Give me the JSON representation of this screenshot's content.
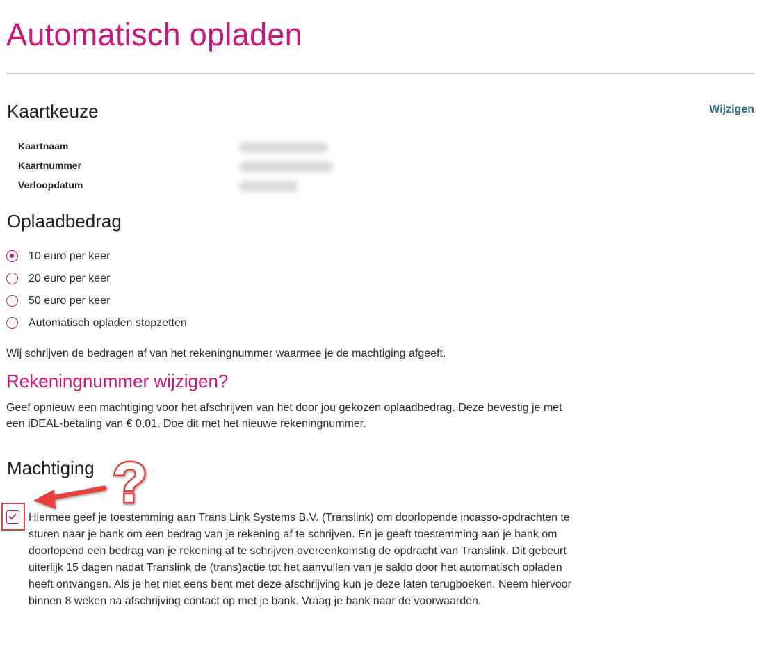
{
  "page": {
    "title": "Automatisch opladen"
  },
  "card_section": {
    "heading": "Kaartkeuze",
    "edit_link": "Wijzigen",
    "fields": [
      {
        "label": "Kaartnaam"
      },
      {
        "label": "Kaartnummer"
      },
      {
        "label": "Verloopdatum"
      }
    ]
  },
  "amount_section": {
    "heading": "Oplaadbedrag",
    "options": [
      {
        "label": "10 euro per keer",
        "checked": true
      },
      {
        "label": "20 euro per keer",
        "checked": false
      },
      {
        "label": "50 euro per keer",
        "checked": false
      },
      {
        "label": "Automatisch opladen stopzetten",
        "checked": false
      }
    ],
    "note": "Wij schrijven de bedragen af van het rekeningnummer waarmee je de machtiging afgeeft."
  },
  "account_section": {
    "heading": "Rekeningnummer wijzigen?",
    "text": "Geef opnieuw een machtiging voor het afschrijven van het door jou gekozen oplaadbedrag. Deze bevestig je met een iDEAL-betaling van € 0,01. Doe dit met het nieuwe rekeningnummer."
  },
  "mandate_section": {
    "heading": "Machtiging",
    "checked": true,
    "text": "Hiermee geef je toestemming aan Trans Link Systems B.V. (Translink) om doorlopende incasso-opdrachten te sturen naar je bank om een bedrag van je rekening af te schrijven. En je geeft toestemming aan je bank om doorlopend een bedrag van je rekening af te schrijven overeenkomstig de opdracht van Translink. Dit gebeurt uiterlijk 15 dagen nadat Translink de (trans)actie tot het aanvullen van je saldo door het automatisch opladen heeft ontvangen. Als je het niet eens bent met deze afschrijving kun je deze laten terugboeken. Neem hiervoor binnen 8 weken na afschrijving contact op met je bank. Vraag je bank naar de voorwaarden."
  },
  "annotation": {
    "mark": "?",
    "color": "#e8413a",
    "icons": [
      "question-mark-icon",
      "red-arrow-icon"
    ]
  },
  "colors": {
    "accent": "#d1147b",
    "link": "#2b6a8f",
    "divider": "#c9c9c9"
  }
}
